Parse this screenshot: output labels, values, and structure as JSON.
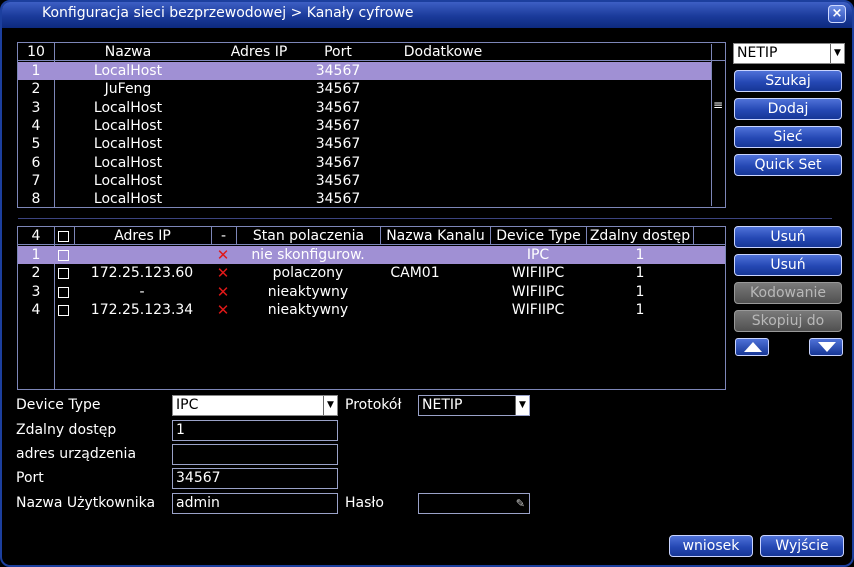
{
  "window": {
    "title": "Konfiguracja sieci bezprzewodowej > Kanały cyfrowe",
    "close_glyph": "×"
  },
  "top_table": {
    "count": "10",
    "headers": [
      "Nazwa",
      "Adres IP",
      "Port",
      "Dodatkowe"
    ],
    "rows": [
      {
        "num": "1",
        "name": "LocalHost",
        "ip": "",
        "port": "34567",
        "extra": "",
        "selected": true
      },
      {
        "num": "2",
        "name": "JuFeng",
        "ip": "",
        "port": "34567",
        "extra": ""
      },
      {
        "num": "3",
        "name": "LocalHost",
        "ip": "",
        "port": "34567",
        "extra": ""
      },
      {
        "num": "4",
        "name": "LocalHost",
        "ip": "",
        "port": "34567",
        "extra": ""
      },
      {
        "num": "5",
        "name": "LocalHost",
        "ip": "",
        "port": "34567",
        "extra": ""
      },
      {
        "num": "6",
        "name": "LocalHost",
        "ip": "",
        "port": "34567",
        "extra": ""
      },
      {
        "num": "7",
        "name": "LocalHost",
        "ip": "",
        "port": "34567",
        "extra": ""
      },
      {
        "num": "8",
        "name": "LocalHost",
        "ip": "",
        "port": "34567",
        "extra": ""
      }
    ]
  },
  "right_panel": {
    "protocol_select": "NETIP",
    "search_label": "Szukaj",
    "add_label": "Dodaj",
    "network_label": "Sieć",
    "quickset_label": "Quick Set"
  },
  "bottom_table": {
    "count": "4",
    "headers": [
      "Adres IP",
      "-",
      "Stan polaczenia",
      "Nazwa Kanalu",
      "Device Type",
      "Zdalny dostęp"
    ],
    "rows": [
      {
        "num": "1",
        "ip": "",
        "status": "nie skonfigurow.",
        "channel": "",
        "type": "IPC",
        "remote": "1",
        "selected": true
      },
      {
        "num": "2",
        "ip": "172.25.123.60",
        "status": "polaczony",
        "channel": "CAM01",
        "type": "WIFIIPC",
        "remote": "1"
      },
      {
        "num": "3",
        "ip": "-",
        "status": "nieaktywny",
        "channel": "",
        "type": "WIFIIPC",
        "remote": "1"
      },
      {
        "num": "4",
        "ip": "172.25.123.34",
        "status": "nieaktywny",
        "channel": "",
        "type": "WIFIIPC",
        "remote": "1"
      }
    ]
  },
  "bottom_buttons": {
    "delete1_label": "Usuń",
    "delete2_label": "Usuń",
    "encode_label": "Kodowanie",
    "copy_label": "Skopiuj do"
  },
  "form": {
    "device_type_label": "Device Type",
    "device_type_value": "IPC",
    "protocol_label": "Protokół",
    "protocol_value": "NETIP",
    "remote_label": "Zdalny dostęp",
    "remote_value": "1",
    "address_label": "adres urządzenia",
    "address_value": "",
    "port_label": "Port",
    "port_value": "34567",
    "user_label": "Nazwa Użytkownika",
    "user_value": "admin",
    "password_label": "Hasło",
    "password_value": ""
  },
  "footer": {
    "apply_label": "wniosek",
    "exit_label": "Wyjście"
  },
  "icons": {
    "x_mark": "✕",
    "dropdown_arrow": "▼",
    "scroll_grip": "≡",
    "key_glyph": "✎"
  },
  "colors": {
    "accent": "#2548b4",
    "selected_row": "#a090d4",
    "error_mark": "#e01818"
  }
}
